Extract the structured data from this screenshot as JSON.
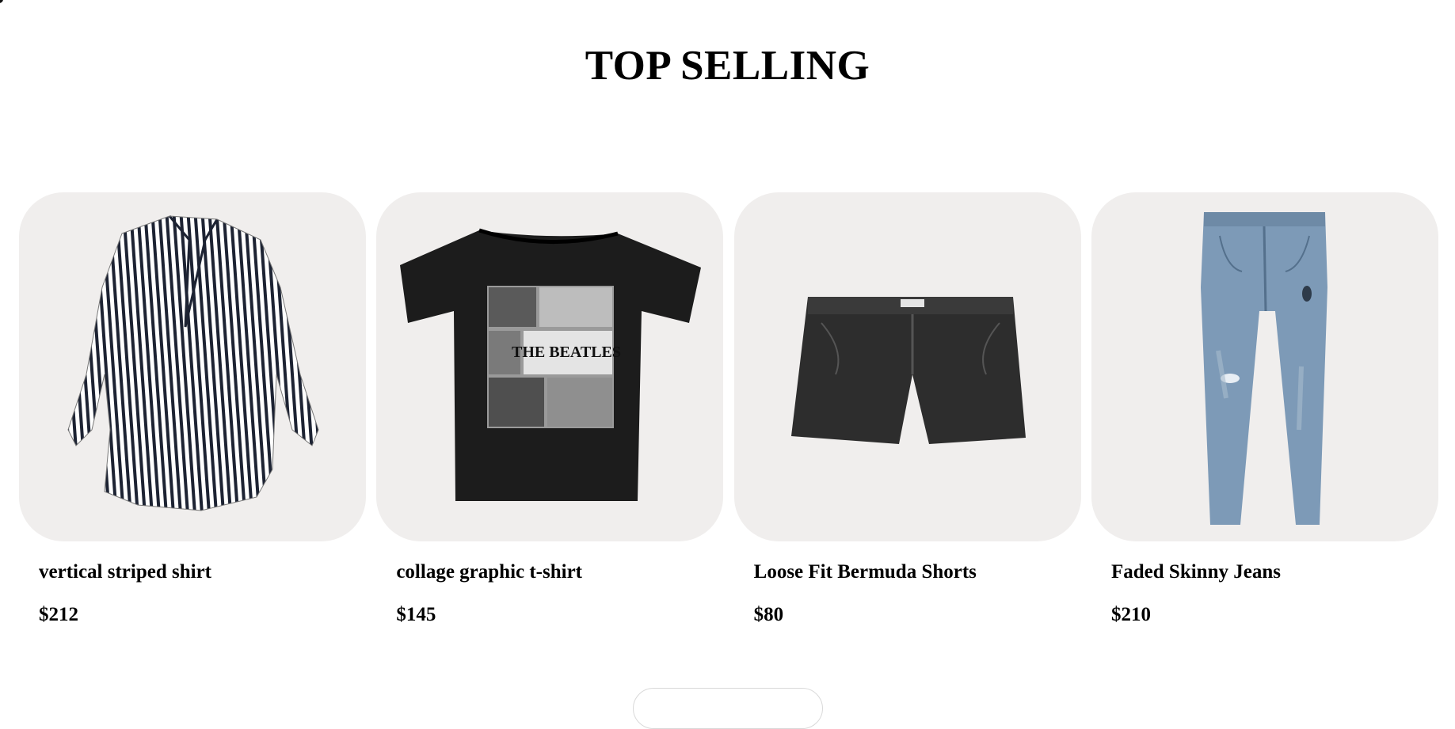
{
  "section": {
    "title": "TOP SELLING"
  },
  "products": [
    {
      "name": "vertical striped shirt",
      "price": "$212",
      "image_icon": "striped-shirt-image"
    },
    {
      "name": "collage graphic t-shirt",
      "price": "$145",
      "image_icon": "graphic-tshirt-image",
      "graphic_text": "THE BEATLES"
    },
    {
      "name": "Loose Fit Bermuda Shorts",
      "price": "$80",
      "image_icon": "denim-shorts-image"
    },
    {
      "name": "Faded Skinny Jeans",
      "price": "$210",
      "image_icon": "skinny-jeans-image"
    }
  ],
  "colors": {
    "card_background": "#f0eeed",
    "text": "#000000"
  }
}
